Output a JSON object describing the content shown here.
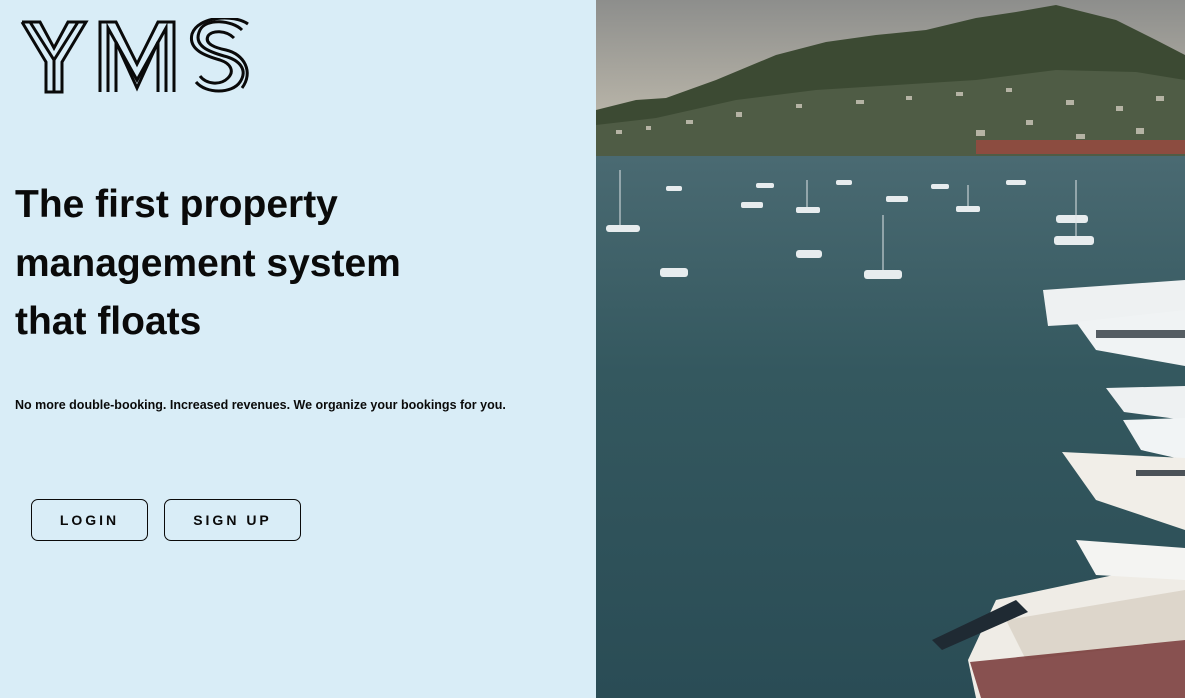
{
  "brand": {
    "logo_text": "YMS",
    "logo_icon": "yms-outline-logo"
  },
  "hero": {
    "headline_line1": "The first property",
    "headline_line2": "management system",
    "headline_line3": "that floats",
    "tagline": "No more double-booking. Increased revenues. We organize your bookings for you."
  },
  "actions": {
    "login_label": "LOGIN",
    "signup_label": "SIGN UP"
  },
  "colors": {
    "left_background": "#d9edf7",
    "text": "#0a0a0a",
    "water": "#2f5663"
  },
  "media": {
    "hero_image": "harbor-yachts-photo"
  }
}
